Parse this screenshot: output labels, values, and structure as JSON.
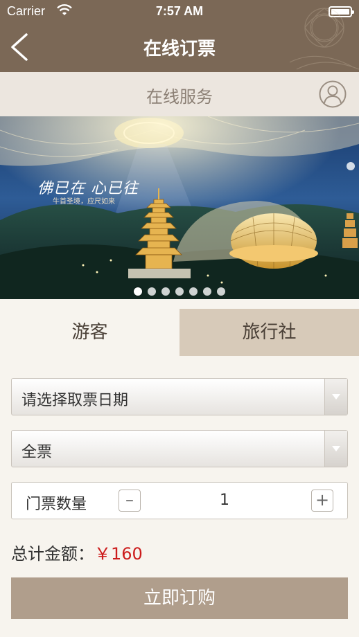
{
  "status_bar": {
    "carrier": "Carrier",
    "time": "7:57 AM"
  },
  "nav": {
    "title": "在线订票",
    "back_icon": "chevron-left-icon"
  },
  "service": {
    "label": "在线服务",
    "user_icon": "user-icon"
  },
  "banner": {
    "slogan": "佛已在 心已往",
    "subtitle": "牛首圣境，应尺如来",
    "dot_count": 7,
    "active_dot": 0
  },
  "tabs": [
    {
      "label": "游客",
      "selected": true
    },
    {
      "label": "旅行社",
      "selected": false
    }
  ],
  "form": {
    "date_select": "请选择取票日期",
    "ticket_type_select": "全票",
    "quantity_label": "门票数量",
    "quantity_minus": "–",
    "quantity_value": "1",
    "quantity_plus": "+"
  },
  "total": {
    "label": "总计金额：",
    "price": "￥160"
  },
  "order_button": "立即订购",
  "colors": {
    "nav_bg": "#7b6856",
    "service_bg": "#ece6df",
    "tab_selected_bg": "#d7cab9",
    "price": "#cc1b1b",
    "button_bg": "#b09e8c"
  }
}
